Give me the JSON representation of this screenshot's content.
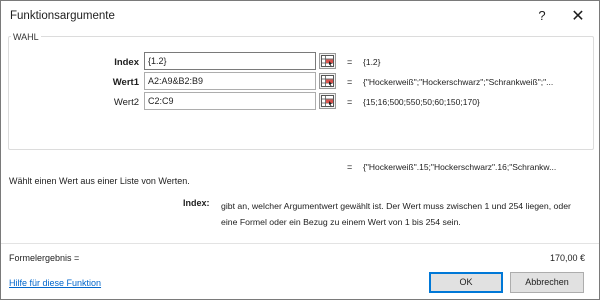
{
  "window": {
    "title": "Funktionsargumente",
    "help_glyph": "?",
    "close_glyph": "✕"
  },
  "function_name": "WAHL",
  "arguments": [
    {
      "label": "Index",
      "value": "{1.2}",
      "result": "{1.2}"
    },
    {
      "label": "Wert1",
      "value": "A2:A9&B2:B9",
      "result": "{\"Hockerweiß\";\"Hockerschwarz\";\"Schrankweiß\";\"..."
    },
    {
      "label": "Wert2",
      "value": "C2:C9",
      "result": "{15;16;500;550;50;60;150;170}"
    }
  ],
  "equals_sign": "=",
  "total_result": "{\"Hockerweiß\".15;\"Hockerschwarz\".16;\"Schrankw...",
  "function_description": "Wählt einen Wert aus einer Liste von Werten.",
  "argument_help": {
    "name": "Index:",
    "text": "gibt an, welcher Argumentwert gewählt ist. Der Wert muss zwischen 1 und 254 liegen, oder eine Formel oder ein Bezug zu einem Wert von 1 bis 254 sein."
  },
  "formula_result": {
    "label": "Formelergebnis =",
    "value": "170,00 €"
  },
  "help_link": "Hilfe für diese Funktion",
  "buttons": {
    "ok": "OK",
    "cancel": "Abbrechen"
  },
  "icons": {
    "ref_button": "range-select-icon"
  }
}
